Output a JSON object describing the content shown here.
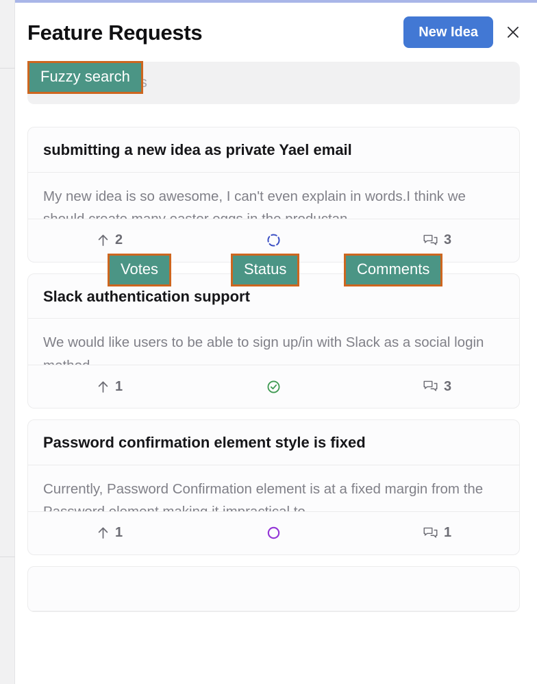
{
  "theme": {
    "accent_blue": "#4278d4",
    "annotation_fill": "#4b9585",
    "annotation_border": "#cd661f",
    "status_in_progress": "#3b4fc4",
    "status_complete": "#3f9a52",
    "status_open": "#9234d6",
    "top_accent": "#a9b6e8",
    "card_bg": "#fcfcfd",
    "search_bg": "#f1f1f2"
  },
  "header": {
    "title": "Feature Requests",
    "new_idea_label": "New Idea",
    "close_icon": "close-icon"
  },
  "search": {
    "placeholder": "Search for posts",
    "value": ""
  },
  "annotations": [
    {
      "id": "fuzzy",
      "label": "Fuzzy search"
    },
    {
      "id": "votes",
      "label": "Votes"
    },
    {
      "id": "status",
      "label": "Status"
    },
    {
      "id": "comments",
      "label": "Comments"
    }
  ],
  "posts": [
    {
      "title": "submitting a new idea as private Yael email",
      "body": "My new idea is so awesome, I can't even explain in words.I think we should create many easter eggs in the productan…",
      "votes": "2",
      "comments": "3",
      "status_icon": "status-in-progress-icon",
      "status_label": "In progress"
    },
    {
      "title": "Slack authentication support",
      "body": "We would like users to be able to sign up/in with Slack as a social login method.",
      "votes": "1",
      "comments": "3",
      "status_icon": "status-complete-icon",
      "status_label": "Complete"
    },
    {
      "title": "Password confirmation element style is fixed",
      "body": "Currently, Password Confirmation element is at a fixed margin from the Password element making it impractical to…",
      "votes": "1",
      "comments": "1",
      "status_icon": "status-open-icon",
      "status_label": "Open"
    }
  ],
  "icons": {
    "upvote": "upvote-arrow-icon",
    "comments": "comments-bubble-icon"
  }
}
